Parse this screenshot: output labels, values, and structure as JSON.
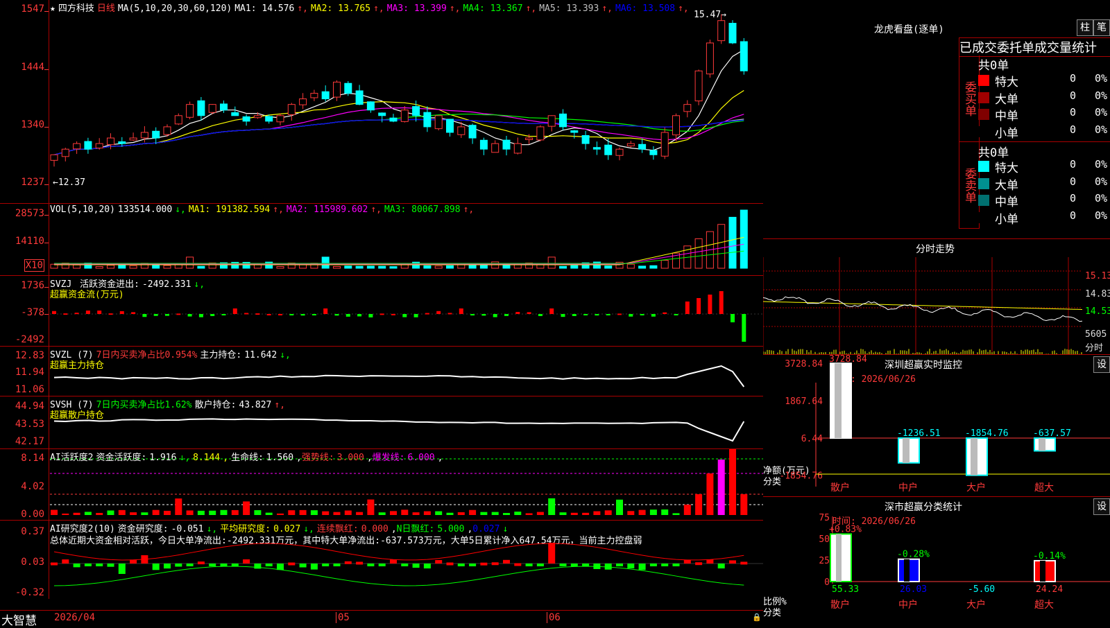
{
  "stock": {
    "name": "四方科技",
    "period": "日线"
  },
  "main": {
    "ma_def": "MA(5,10,20,30,60,120)",
    "ma": [
      {
        "label": "MA1:",
        "value": "14.576",
        "color": "#ffffff"
      },
      {
        "label": "MA2:",
        "value": "13.765",
        "color": "#ffff00"
      },
      {
        "label": "MA3:",
        "value": "13.399",
        "color": "#ff00ff"
      },
      {
        "label": "MA4:",
        "value": "13.367",
        "color": "#00ff00"
      },
      {
        "label": "MA5:",
        "value": "13.393",
        "color": "#c0c0c0"
      },
      {
        "label": "MA6:",
        "value": "13.508",
        "color": "#0000ff"
      }
    ],
    "yaxis": [
      "1547",
      "1444",
      "1340",
      "1237"
    ],
    "high_label": "15.47",
    "low_label": "12.37"
  },
  "vol": {
    "title": "VOL(5,10,20)",
    "value": "133514.000",
    "ma": [
      {
        "label": "MA1:",
        "value": "191382.594",
        "color": "#ffff00"
      },
      {
        "label": "MA2:",
        "value": "115989.602",
        "color": "#ff00ff"
      },
      {
        "label": "MA3:",
        "value": "80067.898",
        "color": "#00ff00"
      }
    ],
    "yaxis": [
      "28573",
      "14110"
    ],
    "unit": "X10"
  },
  "svzj": {
    "title": "SVZJ",
    "label": "活跃资金进出:",
    "value": "-2492.331",
    "sub": "超赢资金流(万元)",
    "yaxis": [
      "1736",
      "-378",
      "-2492"
    ]
  },
  "svzl": {
    "title": "SVZL (7)",
    "label1": "7日内买卖净占比0.954%",
    "label2": "主力持仓:",
    "value": "11.642",
    "sub": "超赢主力持仓",
    "yaxis": [
      "12.83",
      "11.94",
      "11.06"
    ]
  },
  "svsh": {
    "title": "SVSH (7)",
    "label1": "7日内买卖净占比1.62%",
    "label2": "散户持仓:",
    "value": "43.827",
    "sub": "超赢散户持仓",
    "yaxis": [
      "44.94",
      "43.53",
      "42.17"
    ]
  },
  "ai1": {
    "title": "AI活跃度2",
    "label": "资金活跃度:",
    "v1": "1.916",
    "v2": "8.144",
    "l3": "生命线:",
    "v3": "1.560",
    "l4": "强势线:",
    "v4": "3.000",
    "l5": "爆发线:",
    "v5": "6.000",
    "yaxis": [
      "8.14",
      "4.02",
      "0.00"
    ]
  },
  "ai2": {
    "title": "AI研究度2(10)",
    "l1": "资金研究度:",
    "v1": "-0.051",
    "l2": "平均研究度:",
    "v2": "0.027",
    "l3": "连续飘红:",
    "v3": "0.000",
    "l4": "N日飘红:",
    "v4": "5.000",
    "v5": "0.027",
    "yaxis": [
      "0.37",
      "0.03",
      "-0.32"
    ],
    "summary": "总体近期大资金相对活跃，今日大单净流出:-2492.331万元，其中特大单净流出:-637.573万元，大单5日累计净入647.54万元，当前主力控盘弱"
  },
  "dates": [
    "2026/04",
    "05",
    "06"
  ],
  "brand": "大智慧",
  "dragon": {
    "title": "龙虎看盘(逐单)",
    "btn1": "柱",
    "btn2": "笔",
    "tabs": "已成交委托单成交量统计",
    "buy_label": "委买单",
    "sell_label": "委卖单",
    "buy_total": "共0单",
    "sell_total": "共0单",
    "buy": [
      {
        "name": "特大",
        "count": "0",
        "pct": "0%",
        "color": "#ff0000"
      },
      {
        "name": "大单",
        "count": "0",
        "pct": "0%",
        "color": "#a00000"
      },
      {
        "name": "中单",
        "count": "0",
        "pct": "0%",
        "color": "#800000"
      },
      {
        "name": "小单",
        "count": "0",
        "pct": "0%",
        "color": "#000000"
      }
    ],
    "sell": [
      {
        "name": "特大",
        "count": "0",
        "pct": "0%",
        "color": "#00ffff"
      },
      {
        "name": "大单",
        "count": "0",
        "pct": "0%",
        "color": "#009090"
      },
      {
        "name": "中单",
        "count": "0",
        "pct": "0%",
        "color": "#007070"
      },
      {
        "name": "小单",
        "count": "0",
        "pct": "0%",
        "color": "#000000"
      }
    ]
  },
  "intraday": {
    "title": "分时走势",
    "yaxis": [
      "15.13",
      "14.83",
      "14.53",
      "5605"
    ],
    "unit": "分时"
  },
  "sz_monitor": {
    "title": "深圳超赢实时监控",
    "btn": "设",
    "time": "时间: 2026/06/26",
    "yaxis": [
      "3728.84",
      "1867.64",
      "6.44",
      "-1854.76"
    ],
    "ylabel": "净额(万元)",
    "xlabel": "分类",
    "cats": [
      {
        "name": "散户",
        "value": 3728.84,
        "label": "3728.84"
      },
      {
        "name": "中户",
        "value": -1236.51,
        "label": "-1236.51"
      },
      {
        "name": "大户",
        "value": -1854.76,
        "label": "-1854.76"
      },
      {
        "name": "超大",
        "value": -637.57,
        "label": "-637.57"
      }
    ]
  },
  "sz_class": {
    "title": "深市超赢分类统计",
    "btn": "设",
    "time": "时间: 2026/06/26",
    "yaxis": [
      "75",
      "50",
      "25",
      "0"
    ],
    "ylabel": "比例%",
    "xlabel": "分类",
    "cats": [
      {
        "name": "散户",
        "value": 55.33,
        "label": "55.33",
        "chg": "+0.83%",
        "color": "#ffffff",
        "chgcolor": "#ff3a3a"
      },
      {
        "name": "中户",
        "value": 26.03,
        "label": "26.03",
        "chg": "-0.28%",
        "color": "#0000ff",
        "chgcolor": "#00ff00"
      },
      {
        "name": "大户",
        "value": -5.6,
        "label": "-5.60",
        "chg": "",
        "color": "#00ffff",
        "chgcolor": "#00ff00"
      },
      {
        "name": "超大",
        "value": 24.24,
        "label": "24.24",
        "chg": "-0.14%",
        "color": "#ff0000",
        "chgcolor": "#00ff00"
      }
    ]
  }
}
